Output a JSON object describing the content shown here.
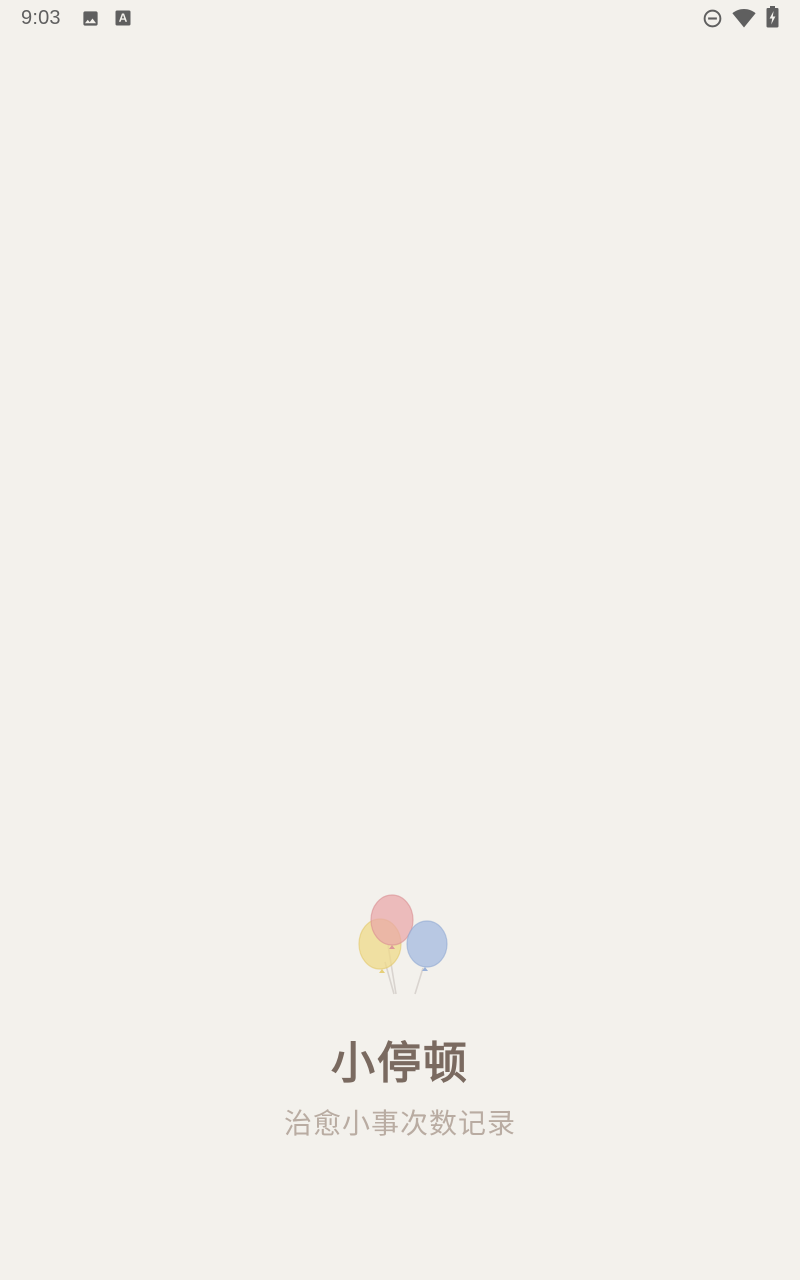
{
  "status_bar": {
    "time": "9:03",
    "icons": [
      "image-icon",
      "font-icon",
      "do-not-disturb-icon",
      "wifi-icon",
      "battery-charging-icon"
    ]
  },
  "splash": {
    "title": "小停顿",
    "subtitle": "治愈小事次数记录",
    "logo": "balloons-icon"
  },
  "colors": {
    "background": "#f3f1ec",
    "title": "#7a6a60",
    "subtitle": "#b9aca2",
    "balloon_red": "#e9a6a8",
    "balloon_yellow": "#efd98a",
    "balloon_blue": "#a7bde0"
  }
}
